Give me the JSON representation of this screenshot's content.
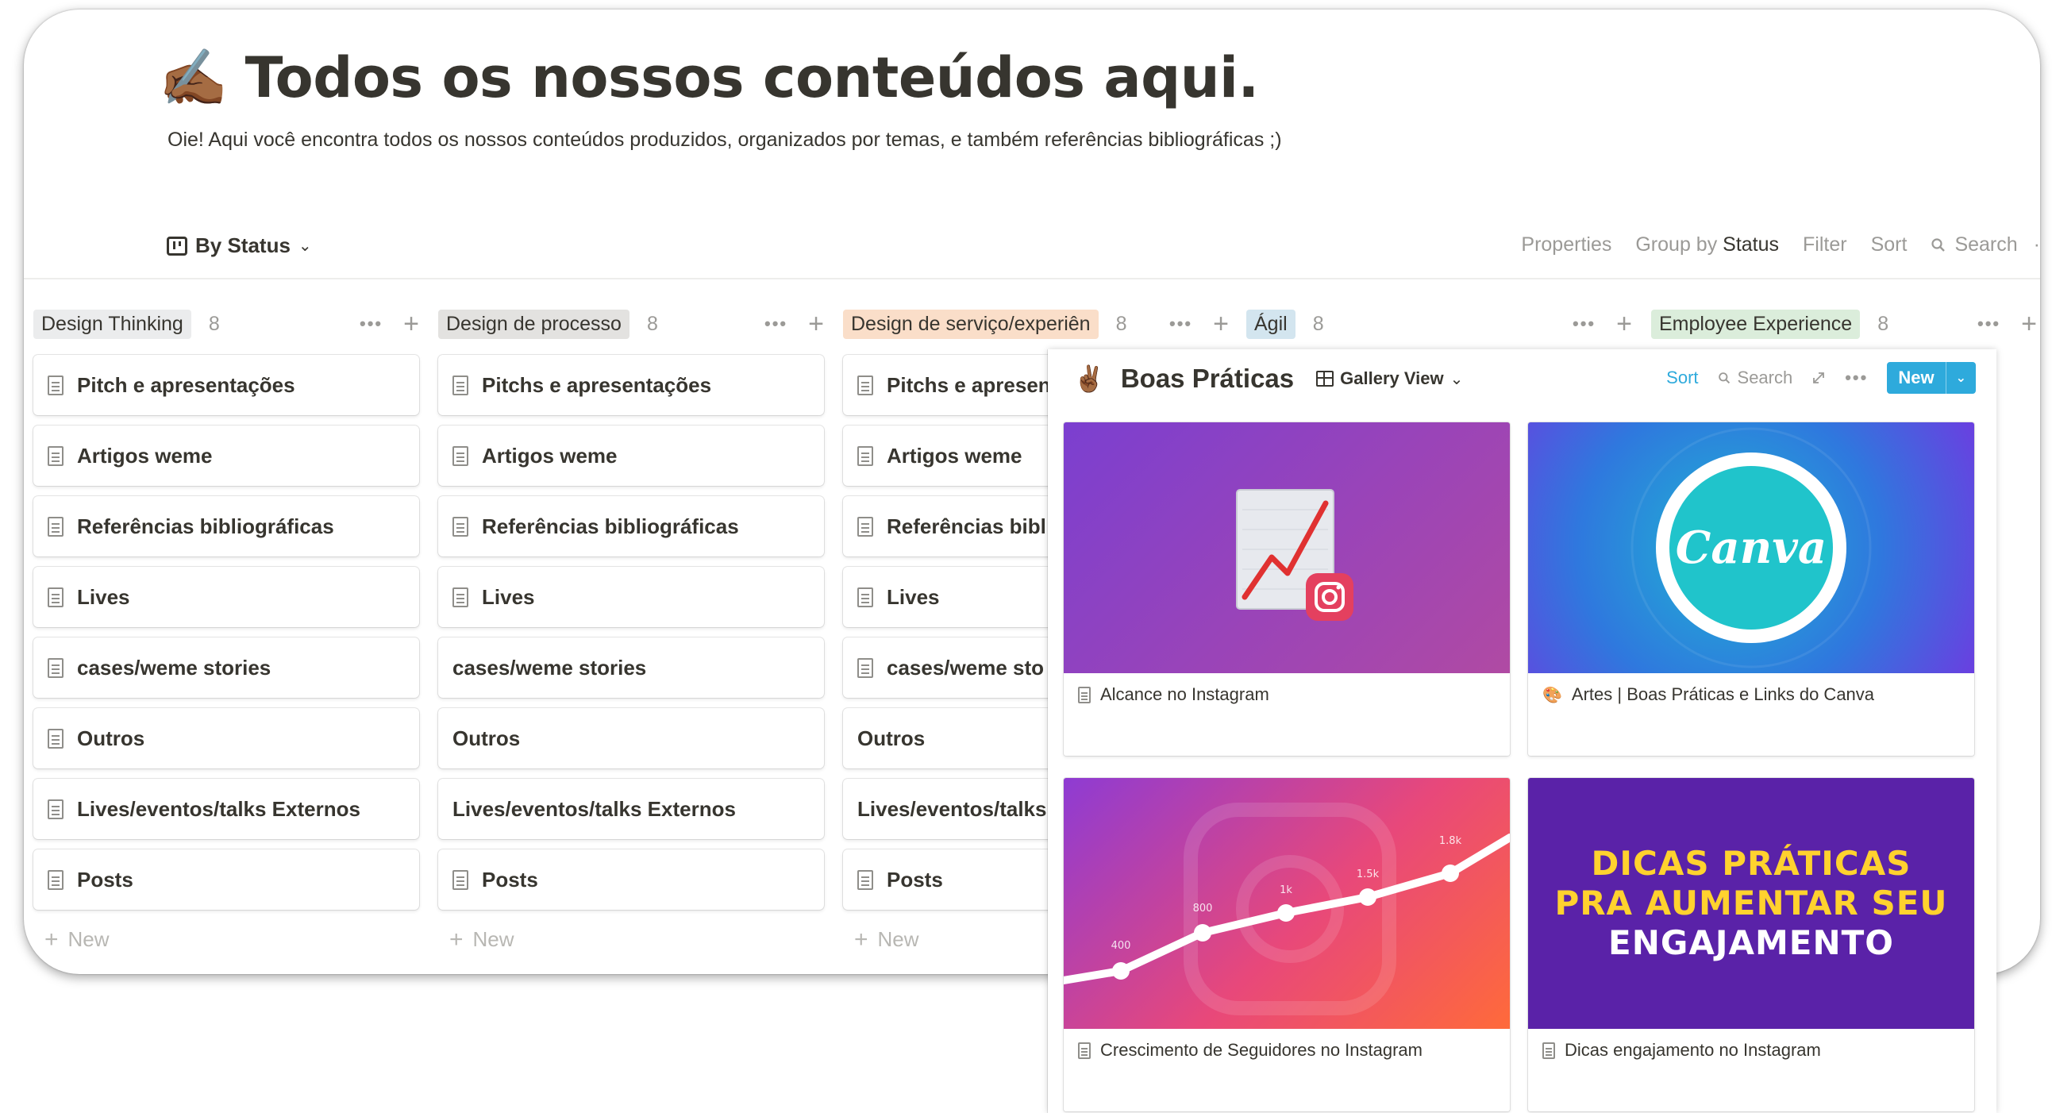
{
  "page": {
    "emoji": "✍🏾",
    "title": "Todos os nossos conteúdos aqui.",
    "description": "Oie! Aqui você encontra todos os nossos conteúdos produzidos, organizados por temas, e também referências bibliográficas ;)"
  },
  "view": {
    "name": "By Status"
  },
  "toolbar": {
    "properties": "Properties",
    "group_by_prefix": "Group by",
    "group_by_value": "Status",
    "filter": "Filter",
    "sort": "Sort",
    "search": "Search",
    "more": "·"
  },
  "columns": [
    {
      "label": "Design Thinking",
      "count": "8",
      "color": "#ebeced",
      "cards": [
        {
          "title": "Pitch e apresentações",
          "icon": true
        },
        {
          "title": "Artigos weme",
          "icon": true
        },
        {
          "title": "Referências bibliográficas",
          "icon": true
        },
        {
          "title": "Lives",
          "icon": true
        },
        {
          "title": "cases/weme stories",
          "icon": true
        },
        {
          "title": "Outros",
          "icon": true
        },
        {
          "title": "Lives/eventos/talks Externos",
          "icon": true
        },
        {
          "title": "Posts",
          "icon": true
        }
      ],
      "new_label": "New"
    },
    {
      "label": "Design de processo",
      "count": "8",
      "color": "#e3e2e0",
      "cards": [
        {
          "title": "Pitchs e apresentações",
          "icon": true
        },
        {
          "title": "Artigos weme",
          "icon": true
        },
        {
          "title": "Referências bibliográficas",
          "icon": true
        },
        {
          "title": "Lives",
          "icon": true
        },
        {
          "title": "cases/weme stories",
          "icon": false
        },
        {
          "title": "Outros",
          "icon": false
        },
        {
          "title": "Lives/eventos/talks Externos",
          "icon": false
        },
        {
          "title": "Posts",
          "icon": true
        }
      ],
      "new_label": "New"
    },
    {
      "label": "Design de serviço/experiên",
      "count": "8",
      "color": "#fadec9",
      "cards": [
        {
          "title": "Pitchs e apresen",
          "icon": true
        },
        {
          "title": "Artigos weme",
          "icon": true
        },
        {
          "title": "Referências bibl",
          "icon": true
        },
        {
          "title": "Lives",
          "icon": true
        },
        {
          "title": "cases/weme sto",
          "icon": true
        },
        {
          "title": "Outros",
          "icon": false
        },
        {
          "title": "Lives/eventos/talks",
          "icon": false
        },
        {
          "title": "Posts",
          "icon": true
        }
      ],
      "new_label": "New"
    },
    {
      "label": "Ágil",
      "count": "8",
      "color": "#d3e5ef",
      "cards": [],
      "new_label": ""
    },
    {
      "label": "Employee Experience",
      "count": "8",
      "color": "#dbeddb",
      "cards": [],
      "new_label": ""
    }
  ],
  "gallery": {
    "emoji": "✌🏾",
    "title": "Boas Práticas",
    "view": "Gallery View",
    "sort": "Sort",
    "search": "Search",
    "new": "New",
    "cards": [
      {
        "title": "Alcance no Instagram"
      },
      {
        "title": "Artes | Boas Práticas e Links do Canva"
      },
      {
        "title": "Crescimento de Seguidores no Instagram"
      },
      {
        "title": "Dicas engajamento no Instagram"
      }
    ],
    "canva_logo": "Canva",
    "growth_points": [
      "400",
      "800",
      "1k",
      "1.5k",
      "1.8k"
    ],
    "dicas": [
      "DICAS PRÁTICAS",
      "PRA AUMENTAR SEU",
      "ENGAJAMENTO"
    ]
  }
}
